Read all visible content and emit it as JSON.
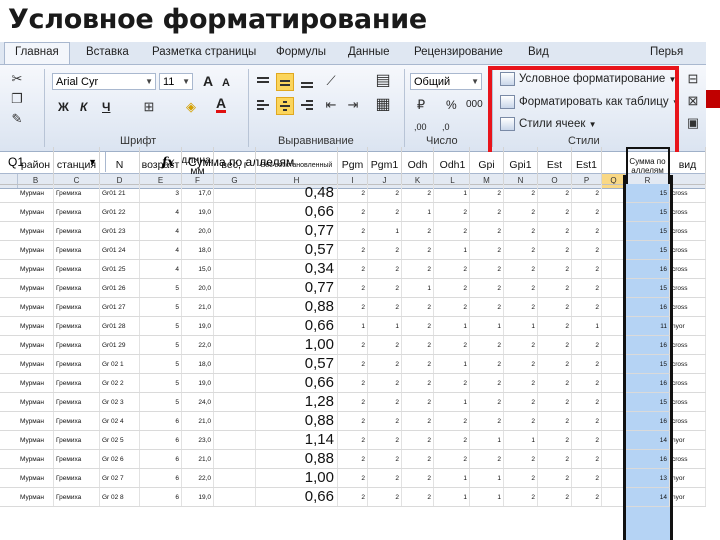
{
  "slide_title": "Условное форматирование",
  "tabs": [
    "Главная",
    "Вставка",
    "Разметка страницы",
    "Формулы",
    "Данные",
    "Рецензирование",
    "Вид",
    "Перья"
  ],
  "ribbon": {
    "font_name": "Arial Cyr",
    "font_size": "11",
    "bold": "Ж",
    "italic": "К",
    "underline": "Ч",
    "font_grow": "A",
    "font_shrink": "A",
    "font_color": "A",
    "number_format": "Общий",
    "percent": "%",
    "thousands": "000",
    "dec_inc": ",00",
    "dec_dec": ",0",
    "group_font": "Шрифт",
    "group_align": "Выравнивание",
    "group_number": "Число",
    "group_styles": "Стили",
    "conditional_formatting": "Условное форматирование",
    "format_as_table": "Форматировать как таблицу",
    "cell_styles": "Стили ячеек"
  },
  "formula_bar": {
    "name_box": "Q1",
    "fx": "fx",
    "value": "Сумма по аллелям"
  },
  "column_letters": [
    "B",
    "C",
    "D",
    "E",
    "F",
    "G",
    "H",
    "I",
    "J",
    "K",
    "L",
    "M",
    "N",
    "O",
    "P",
    "Q",
    "R"
  ],
  "headers": [
    "район",
    "станция",
    "N",
    "возраст",
    "длина, мм",
    "вес, г",
    "Вес восстановленный",
    "Pgm",
    "Pgm1",
    "Odh",
    "Odh1",
    "Gpi",
    "Gpi1",
    "Est",
    "Est1",
    "Сумма по аллелям",
    "вид"
  ],
  "rows": [
    [
      "Мурман",
      "Гремиха",
      "Gr01 21",
      "3",
      "17,0",
      "",
      "0,48",
      "2",
      "2",
      "2",
      "1",
      "2",
      "2",
      "2",
      "2",
      "15",
      "cross"
    ],
    [
      "Мурман",
      "Гремиха",
      "Gr01 22",
      "4",
      "19,0",
      "",
      "0,66",
      "2",
      "2",
      "1",
      "2",
      "2",
      "2",
      "2",
      "2",
      "15",
      "cross"
    ],
    [
      "Мурман",
      "Гремиха",
      "Gr01 23",
      "4",
      "20,0",
      "",
      "0,77",
      "2",
      "1",
      "2",
      "2",
      "2",
      "2",
      "2",
      "2",
      "15",
      "cross"
    ],
    [
      "Мурман",
      "Гремиха",
      "Gr01 24",
      "4",
      "18,0",
      "",
      "0,57",
      "2",
      "2",
      "2",
      "1",
      "2",
      "2",
      "2",
      "2",
      "15",
      "cross"
    ],
    [
      "Мурман",
      "Гремиха",
      "Gr01 25",
      "4",
      "15,0",
      "",
      "0,34",
      "2",
      "2",
      "2",
      "2",
      "2",
      "2",
      "2",
      "2",
      "16",
      "cross"
    ],
    [
      "Мурман",
      "Гремиха",
      "Gr01 26",
      "5",
      "20,0",
      "",
      "0,77",
      "2",
      "2",
      "1",
      "2",
      "2",
      "2",
      "2",
      "2",
      "15",
      "cross"
    ],
    [
      "Мурман",
      "Гремиха",
      "Gr01 27",
      "5",
      "21,0",
      "",
      "0,88",
      "2",
      "2",
      "2",
      "2",
      "2",
      "2",
      "2",
      "2",
      "16",
      "cross"
    ],
    [
      "Мурман",
      "Гремиха",
      "Gr01 28",
      "5",
      "19,0",
      "",
      "0,66",
      "1",
      "1",
      "2",
      "1",
      "1",
      "1",
      "2",
      "1",
      "11",
      "nyor"
    ],
    [
      "Мурман",
      "Гремиха",
      "Gr01 29",
      "5",
      "22,0",
      "",
      "1,00",
      "2",
      "2",
      "2",
      "2",
      "2",
      "2",
      "2",
      "2",
      "16",
      "cross"
    ],
    [
      "Мурман",
      "Гремиха",
      "Gr 02 1",
      "5",
      "18,0",
      "",
      "0,57",
      "2",
      "2",
      "2",
      "1",
      "2",
      "2",
      "2",
      "2",
      "15",
      "cross"
    ],
    [
      "Мурман",
      "Гремиха",
      "Gr 02 2",
      "5",
      "19,0",
      "",
      "0,66",
      "2",
      "2",
      "2",
      "2",
      "2",
      "2",
      "2",
      "2",
      "16",
      "cross"
    ],
    [
      "Мурман",
      "Гремиха",
      "Gr 02 3",
      "5",
      "24,0",
      "",
      "1,28",
      "2",
      "2",
      "2",
      "1",
      "2",
      "2",
      "2",
      "2",
      "15",
      "cross"
    ],
    [
      "Мурман",
      "Гремиха",
      "Gr 02 4",
      "6",
      "21,0",
      "",
      "0,88",
      "2",
      "2",
      "2",
      "2",
      "2",
      "2",
      "2",
      "2",
      "16",
      "cross"
    ],
    [
      "Мурман",
      "Гремиха",
      "Gr 02 5",
      "6",
      "23,0",
      "",
      "1,14",
      "2",
      "2",
      "2",
      "2",
      "1",
      "1",
      "2",
      "2",
      "14",
      "nyor"
    ],
    [
      "Мурман",
      "Гремиха",
      "Gr 02 6",
      "6",
      "21,0",
      "",
      "0,88",
      "2",
      "2",
      "2",
      "2",
      "2",
      "2",
      "2",
      "2",
      "16",
      "cross"
    ],
    [
      "Мурман",
      "Гремиха",
      "Gr 02 7",
      "6",
      "22,0",
      "",
      "1,00",
      "2",
      "2",
      "2",
      "1",
      "1",
      "2",
      "2",
      "2",
      "13",
      "nyor"
    ],
    [
      "Мурман",
      "Гремиха",
      "Gr 02 8",
      "6",
      "19,0",
      "",
      "0,66",
      "2",
      "2",
      "2",
      "1",
      "1",
      "2",
      "2",
      "2",
      "14",
      "nyor"
    ]
  ]
}
